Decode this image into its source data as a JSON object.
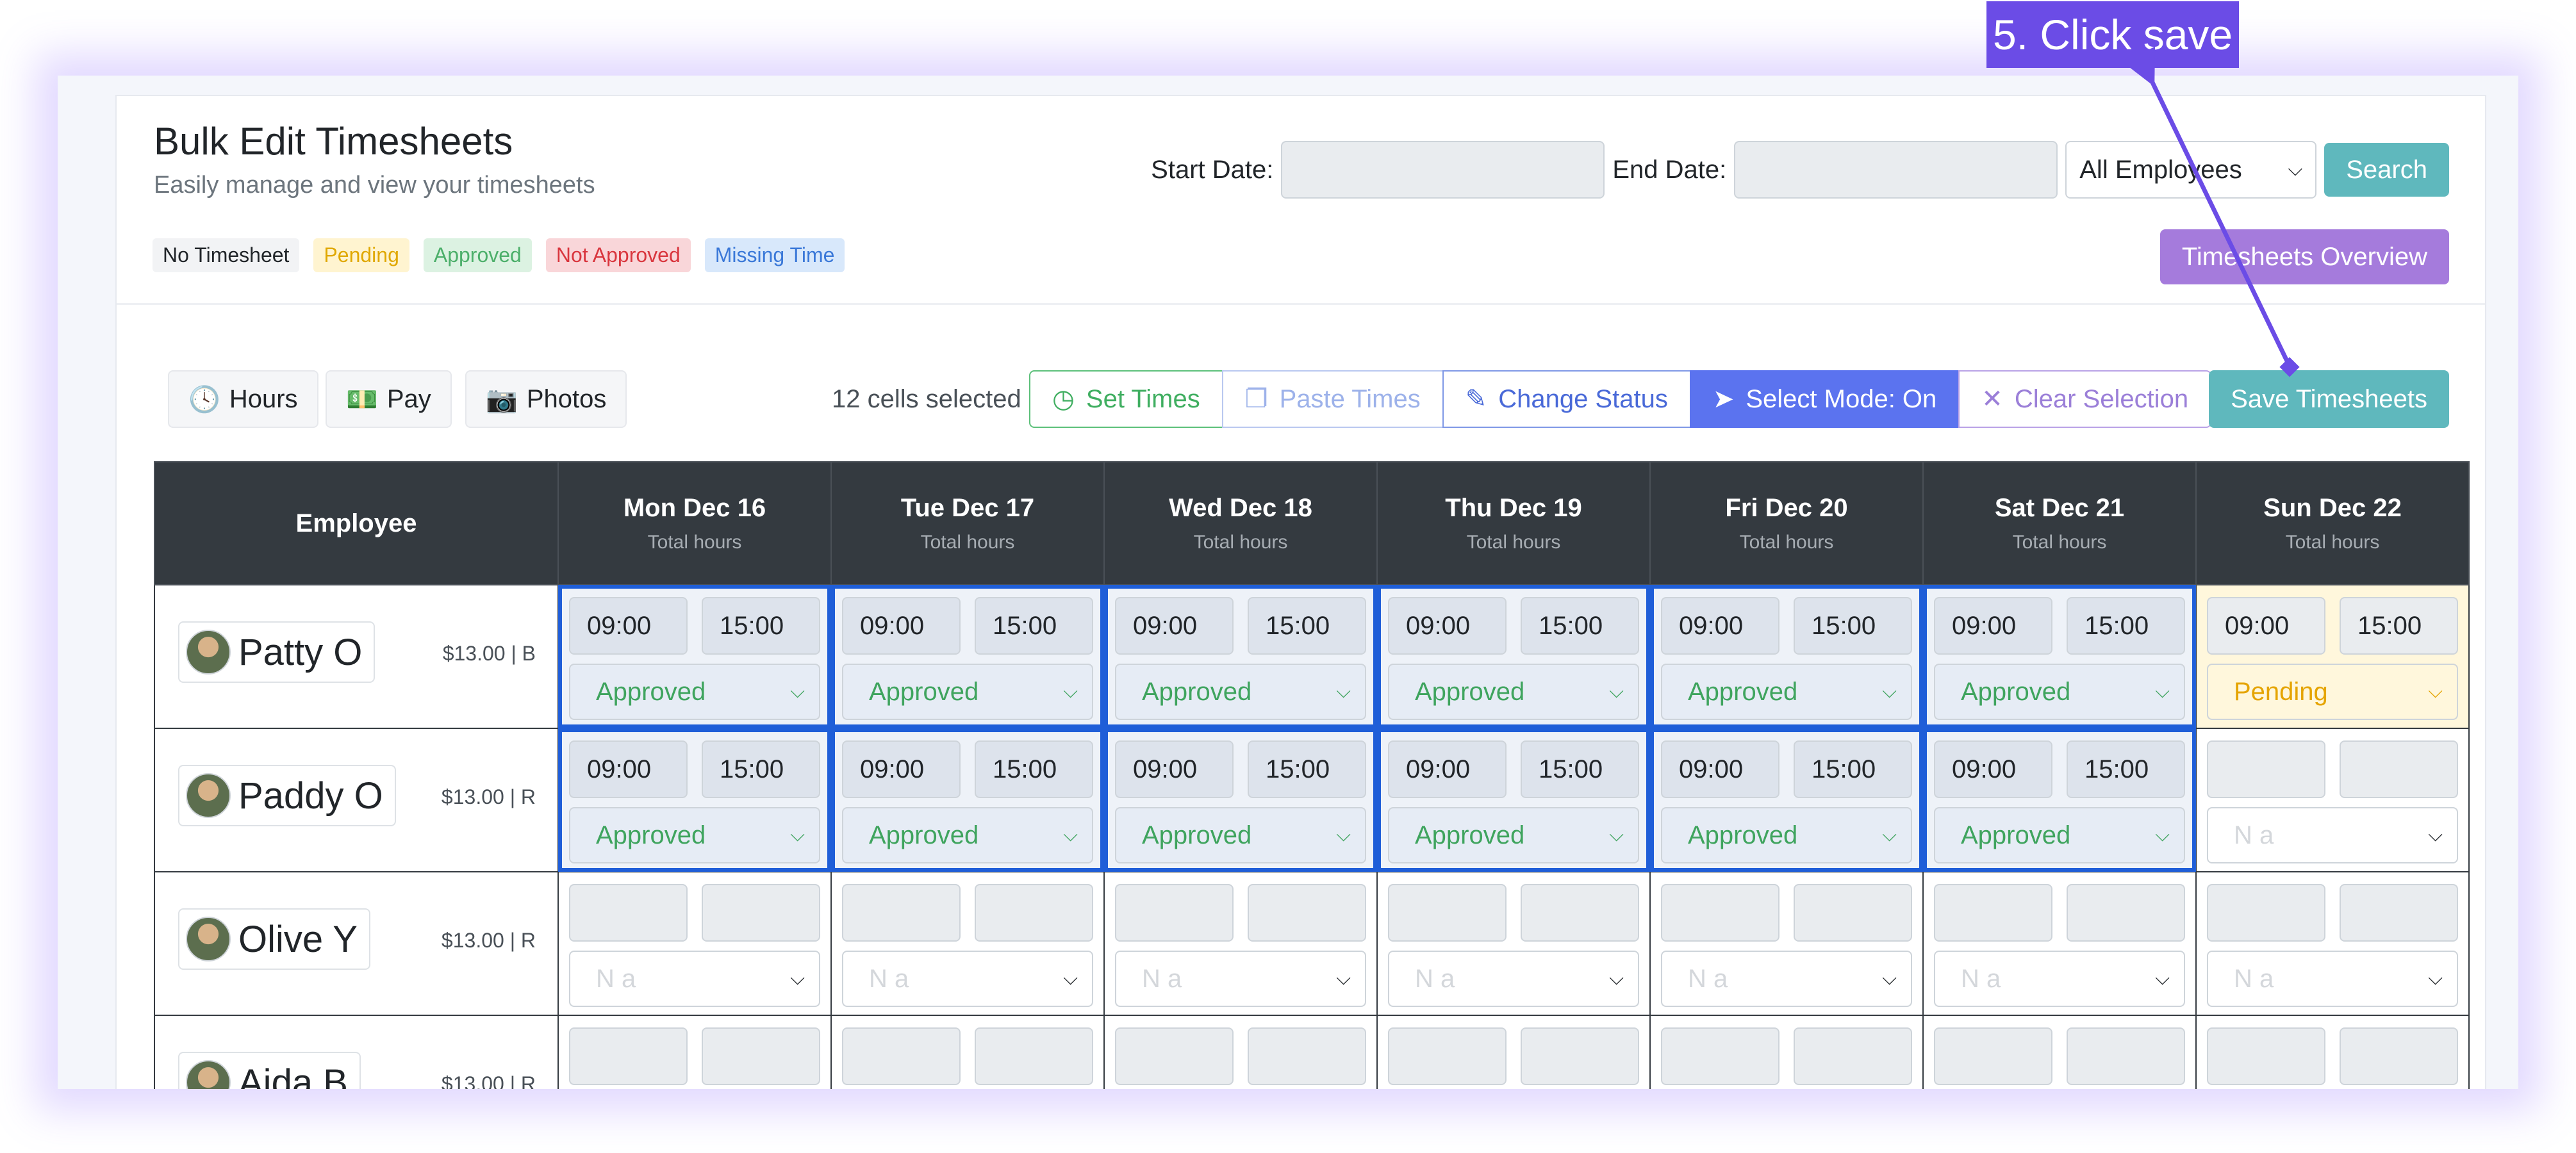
{
  "callout": {
    "text": "5. Click save"
  },
  "header": {
    "title": "Bulk Edit Timesheets",
    "subtitle": "Easily manage and view your timesheets",
    "legend": [
      "No Timesheet",
      "Pending",
      "Approved",
      "Not Approved",
      "Missing Time"
    ]
  },
  "filters": {
    "start_label": "Start Date:",
    "end_label": "End Date:",
    "employee_select": "All Employees",
    "search_label": "Search",
    "overview_label": "Timesheets Overview"
  },
  "toolbar": {
    "hours": "Hours",
    "pay": "Pay",
    "photos": "Photos",
    "selected_count": "12 cells selected",
    "set_times": "Set Times",
    "paste_times": "Paste Times",
    "change_status": "Change Status",
    "select_mode": "Select Mode: On",
    "clear_selection": "Clear Selection",
    "save": "Save Timesheets"
  },
  "table": {
    "employee_header": "Employee",
    "total_label": "Total hours",
    "days": [
      "Mon Dec 16",
      "Tue Dec 17",
      "Wed Dec 18",
      "Thu Dec 19",
      "Fri Dec 20",
      "Sat Dec 21",
      "Sun Dec 22"
    ],
    "placeholder_status": "N a",
    "employees": [
      {
        "name": "Patty O",
        "rate": "$13.00 | B",
        "start": "09:00",
        "end": "15:00",
        "status": "Approved",
        "pending_status": "Pending"
      },
      {
        "name": "Paddy O",
        "rate": "$13.00 | R",
        "start": "09:00",
        "end": "15:00",
        "status": "Approved"
      },
      {
        "name": "Olive Y",
        "rate": "$13.00 | R"
      },
      {
        "name": "Aida B",
        "rate": "$13.00 | R"
      }
    ]
  }
}
